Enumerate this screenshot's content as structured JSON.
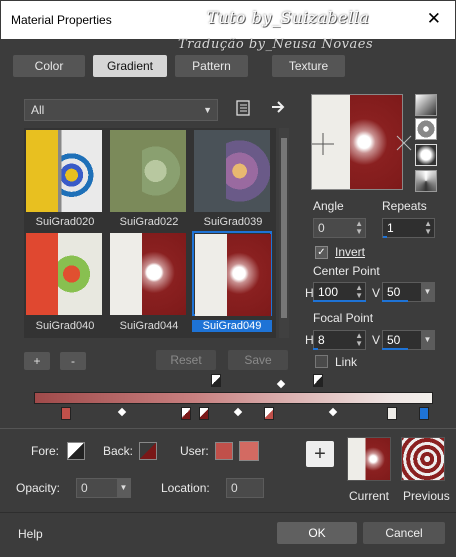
{
  "window": {
    "title": "Material Properties",
    "watermark_line1": "Tuto by_Suizabella",
    "watermark_line2": "Tradução by_Neusa Novaes"
  },
  "tabs": [
    {
      "label": "Color",
      "active": false
    },
    {
      "label": "Gradient",
      "active": true
    },
    {
      "label": "Pattern",
      "active": false
    },
    {
      "label": "Texture",
      "active": false
    }
  ],
  "library": {
    "category": "All",
    "items": [
      {
        "label": "SuiGrad020"
      },
      {
        "label": "SuiGrad022"
      },
      {
        "label": "SuiGrad039"
      },
      {
        "label": "SuiGrad040"
      },
      {
        "label": "SuiGrad044"
      },
      {
        "label": "SuiGrad049",
        "selected": true
      }
    ],
    "add_label": "+",
    "remove_label": "-",
    "reset_label": "Reset",
    "save_label": "Save"
  },
  "settings": {
    "angle_label": "Angle",
    "angle_value": "0",
    "repeats_label": "Repeats",
    "repeats_value": "1",
    "invert_label": "Invert",
    "invert_checked": true,
    "center_point_label": "Center Point",
    "center_h_label": "H",
    "center_h_value": "100",
    "center_v_label": "V",
    "center_v_value": "50",
    "focal_point_label": "Focal Point",
    "focal_h_label": "H",
    "focal_h_value": "8",
    "focal_v_label": "V",
    "focal_v_value": "50",
    "link_label": "Link",
    "link_checked": false
  },
  "editor": {
    "fore_label": "Fore:",
    "back_label": "Back:",
    "user_label": "User:",
    "opacity_label": "Opacity:",
    "opacity_value": "0",
    "location_label": "Location:",
    "location_value": "0"
  },
  "compare": {
    "add_label": "+",
    "current_label": "Current",
    "previous_label": "Previous"
  },
  "footer": {
    "help_label": "Help",
    "ok_label": "OK",
    "cancel_label": "Cancel"
  },
  "colors": {
    "accent": "#1e73d6",
    "dark_red": "#7a1818",
    "user_swatch_1": "#c0504a",
    "user_swatch_2": "#d36a62"
  }
}
